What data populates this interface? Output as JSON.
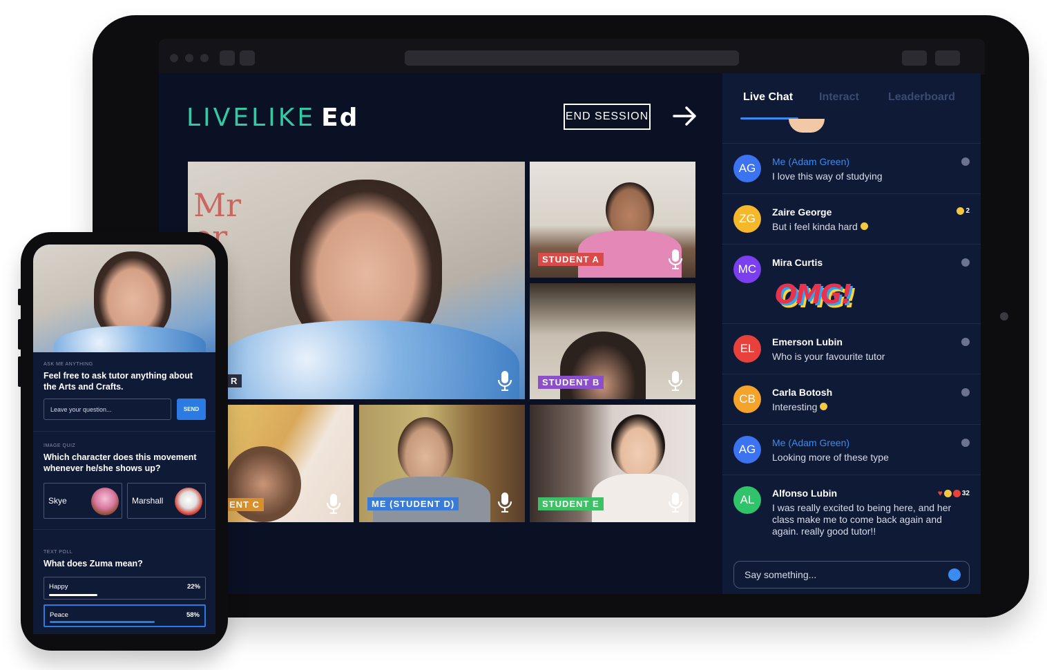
{
  "brand": {
    "logo_main": "LIVELIKE",
    "logo_sub": "Ed"
  },
  "session": {
    "end_label": "END SESSION"
  },
  "tiles": {
    "tutor_label": "R",
    "student_a": "STUDENT A",
    "student_b": "STUDENT B",
    "student_c": "ENT C",
    "student_d": "ME (STUDENT D)",
    "student_e": "STUDENT E"
  },
  "chat": {
    "tabs": [
      "Live Chat",
      "Interact",
      "Leaderboard"
    ],
    "messages": [
      {
        "initials": "AG",
        "name": "Me (Adam Green)",
        "text": "I love this way of studying",
        "color": "#3b73f0"
      },
      {
        "initials": "ZG",
        "name": "Zaire George",
        "text": "But i feel kinda hard",
        "color": "#f5b82a",
        "reaction_count": "2"
      },
      {
        "initials": "MC",
        "name": "Mira Curtis",
        "text": "",
        "sticker": "OMG!",
        "color": "#7b3ff0"
      },
      {
        "initials": "EL",
        "name": "Emerson Lubin",
        "text": "Who is your favourite tutor",
        "color": "#e8413c"
      },
      {
        "initials": "CB",
        "name": "Carla Botosh",
        "text": "Interesting",
        "color": "#f5a32a"
      },
      {
        "initials": "AG",
        "name": "Me (Adam Green)",
        "text": "Looking more of these type",
        "color": "#3b73f0"
      },
      {
        "initials": "AL",
        "name": "Alfonso Lubin",
        "text": "I was really excited to being here, and her class make me to come back again and again. really good tutor!!",
        "color": "#2fc46a",
        "reaction_count": "32"
      }
    ],
    "input_placeholder": "Say something..."
  },
  "phone": {
    "ask": {
      "section": "ASK ME ANYTHING",
      "title": "Feel free to ask tutor anything about the Arts and Crafts.",
      "placeholder": "Leave your question...",
      "send": "SEND"
    },
    "quiz": {
      "section": "IMAGE QUIZ",
      "title": "Which character does this movement whenever he/she shows up?",
      "options": [
        "Skye",
        "Marshall"
      ]
    },
    "poll": {
      "section": "TEXT POLL",
      "title": "What does Zuma mean?",
      "options": [
        {
          "label": "Happy",
          "percent": "22%",
          "fraction": 0.3
        },
        {
          "label": "Peace",
          "percent": "58%",
          "fraction": 0.66
        }
      ]
    }
  }
}
